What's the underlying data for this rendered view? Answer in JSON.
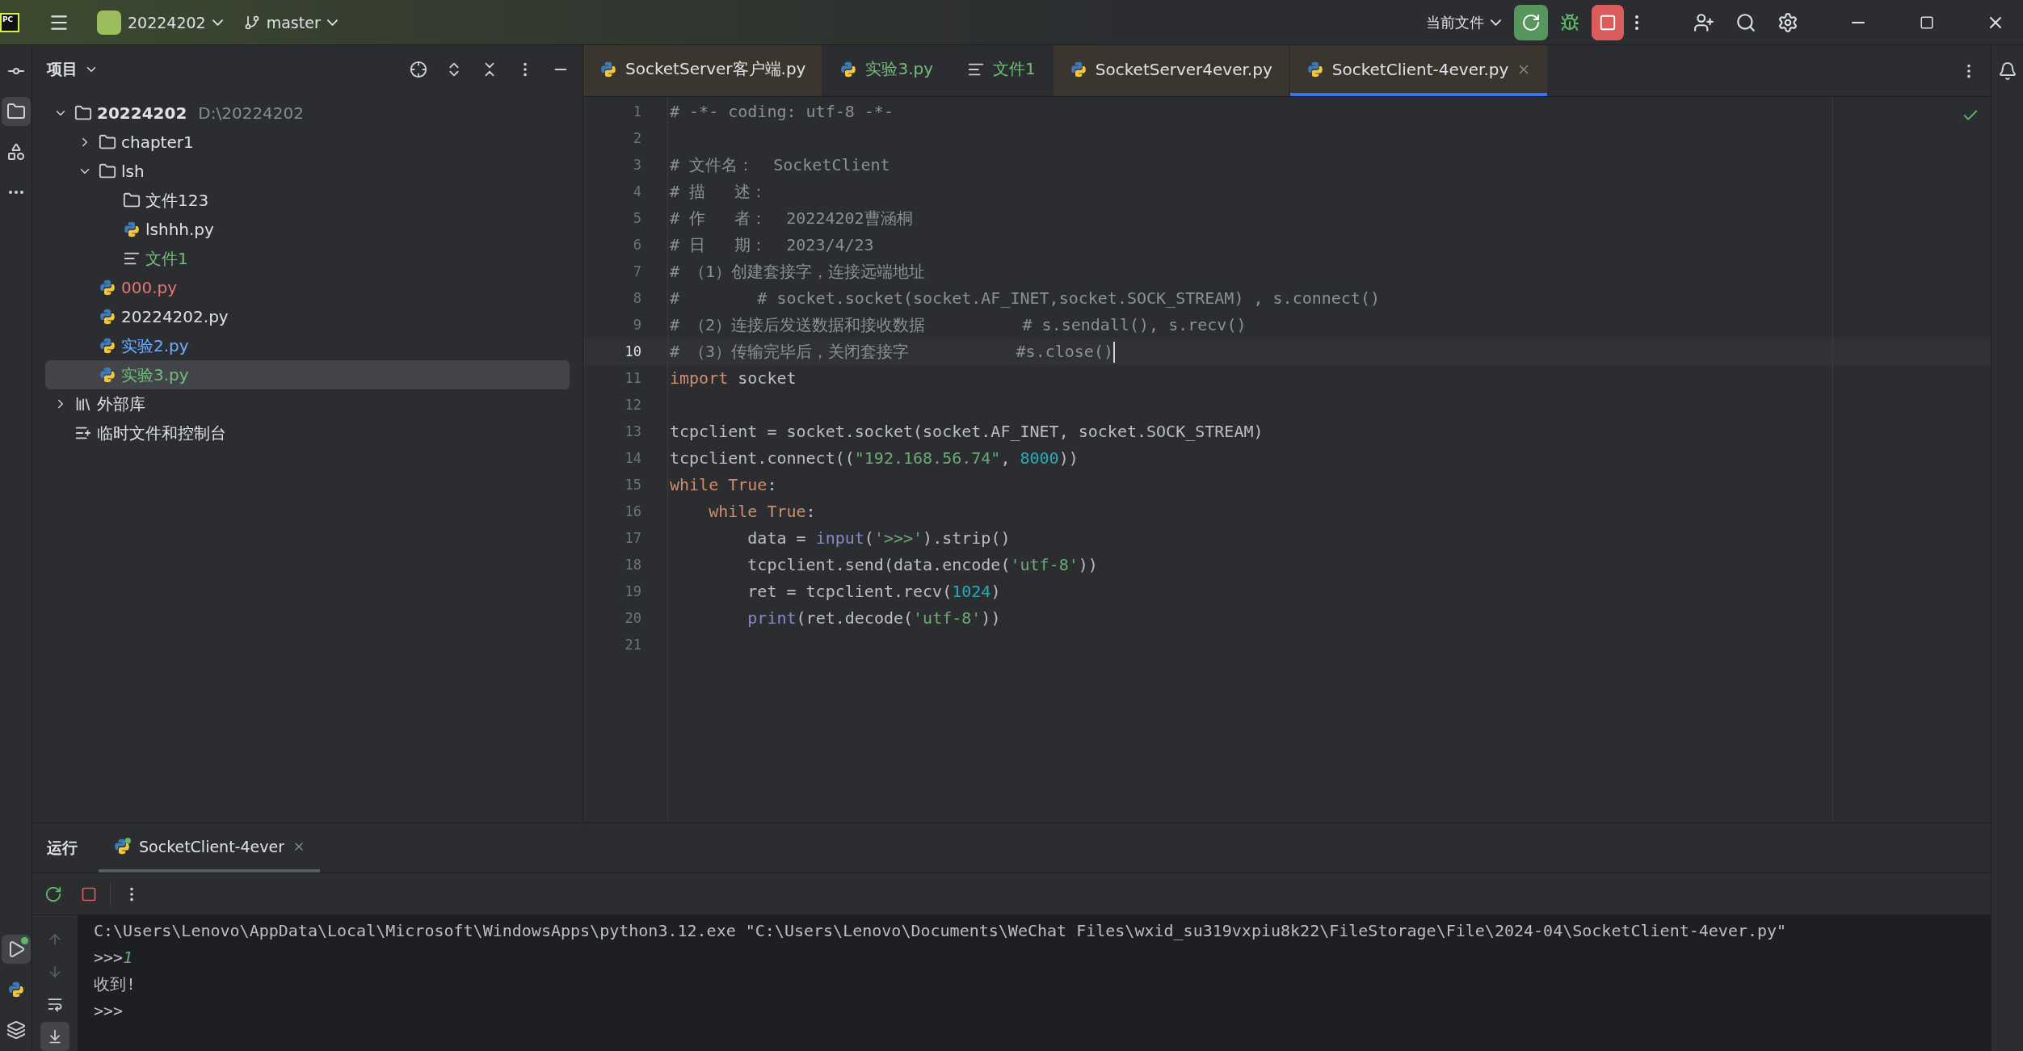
{
  "title_bar": {
    "logo": "PC",
    "project": "20224202",
    "branch": "master",
    "run_config": "当前文件"
  },
  "project_panel": {
    "title": "项目",
    "tree": [
      {
        "name": "20224202",
        "path": "D:\\20224202",
        "kind": "folder",
        "expanded": true,
        "selected": false,
        "color": "#dfe1e5",
        "children": [
          {
            "name": "chapter1",
            "kind": "folder",
            "expanded": false,
            "selected": false,
            "color": "#dfe1e5"
          },
          {
            "name": "lsh",
            "kind": "folder",
            "expanded": true,
            "selected": false,
            "color": "#dfe1e5",
            "children": [
              {
                "name": "文件123",
                "kind": "folder",
                "selected": false,
                "color": "#dfe1e5"
              },
              {
                "name": "lshhh.py",
                "kind": "python",
                "selected": false,
                "color": "#dfe1e5"
              },
              {
                "name": "文件1",
                "kind": "text",
                "selected": false,
                "color": "#73bd79"
              }
            ]
          },
          {
            "name": "000.py",
            "kind": "python",
            "selected": false,
            "color": "#e37774"
          },
          {
            "name": "20224202.py",
            "kind": "python",
            "selected": false,
            "color": "#dfe1e5"
          },
          {
            "name": "实验2.py",
            "kind": "python",
            "selected": false,
            "color": "#70aeff"
          },
          {
            "name": "实验3.py",
            "kind": "python",
            "selected": true,
            "color": "#73bd79"
          }
        ]
      },
      {
        "name": "外部库",
        "kind": "library",
        "expanded": false,
        "selected": false,
        "color": "#dfe1e5"
      },
      {
        "name": "临时文件和控制台",
        "kind": "scratches",
        "selected": false,
        "color": "#dfe1e5"
      }
    ]
  },
  "editor": {
    "tabs": [
      {
        "label": "SocketServer客户端.py",
        "kind": "python",
        "color": "#dfe1e5",
        "tinted": true,
        "selected": false
      },
      {
        "label": "实验3.py",
        "kind": "python",
        "color": "#73bd79",
        "tinted": false,
        "selected": false
      },
      {
        "label": "文件1",
        "kind": "text",
        "color": "#73bd79",
        "tinted": false,
        "selected": false
      },
      {
        "label": "SocketServer4ever.py",
        "kind": "python",
        "color": "#dfe1e5",
        "tinted": true,
        "selected": false
      },
      {
        "label": "SocketClient-4ever.py",
        "kind": "python",
        "color": "#dfe1e5",
        "tinted": true,
        "selected": true
      }
    ],
    "lines": [
      {
        "number": "1",
        "current": false,
        "tokens": [
          {
            "kind": "comment",
            "text": "# -*- coding: utf-8 -*-"
          }
        ]
      },
      {
        "number": "2",
        "current": false
      },
      {
        "number": "3",
        "current": false,
        "tokens": [
          {
            "kind": "comment",
            "text": "# 文件名：  SocketClient"
          }
        ]
      },
      {
        "number": "4",
        "current": false,
        "tokens": [
          {
            "kind": "comment",
            "text": "# 描   述："
          }
        ]
      },
      {
        "number": "5",
        "current": false,
        "tokens": [
          {
            "kind": "comment",
            "text": "# 作   者：  20224202曹涵桐"
          }
        ]
      },
      {
        "number": "6",
        "current": false,
        "tokens": [
          {
            "kind": "comment",
            "text": "# 日   期：  2023/4/23"
          }
        ]
      },
      {
        "number": "7",
        "current": false,
        "tokens": [
          {
            "kind": "comment",
            "text": "# （1）创建套接字，连接远端地址"
          }
        ]
      },
      {
        "number": "8",
        "current": false,
        "tokens": [
          {
            "kind": "comment",
            "text": "#        # socket.socket(socket.AF_INET,socket.SOCK_STREAM) , s.connect()"
          }
        ]
      },
      {
        "number": "9",
        "current": false,
        "tokens": [
          {
            "kind": "comment",
            "text": "# （2）连接后发送数据和接收数据          # s.sendall(), s.recv()"
          }
        ]
      },
      {
        "number": "10",
        "current": true,
        "tokens": [
          {
            "kind": "comment",
            "text": "# （3）传输完毕后，关闭套接字           #s.close()"
          }
        ]
      },
      {
        "number": "11",
        "current": false,
        "tokens": [
          {
            "kind": "keyword",
            "text": "import"
          },
          {
            "kind": "plain",
            "text": " socket"
          }
        ]
      },
      {
        "number": "12",
        "current": false
      },
      {
        "number": "13",
        "current": false,
        "tokens": [
          {
            "kind": "plain",
            "text": "tcpclient = socket.socket(socket.AF_INET, socket.SOCK_STREAM)"
          }
        ]
      },
      {
        "number": "14",
        "current": false,
        "tokens": [
          {
            "kind": "plain",
            "text": "tcpclient.connect(("
          },
          {
            "kind": "string",
            "text": "\"192.168.56.74\""
          },
          {
            "kind": "plain",
            "text": ", "
          },
          {
            "kind": "number",
            "text": "8000"
          },
          {
            "kind": "plain",
            "text": "))"
          }
        ]
      },
      {
        "number": "15",
        "current": false,
        "tokens": [
          {
            "kind": "keyword",
            "text": "while True"
          },
          {
            "kind": "plain",
            "text": ":"
          }
        ]
      },
      {
        "number": "16",
        "current": false,
        "tokens": [
          {
            "kind": "keyword",
            "text": "    while True"
          },
          {
            "kind": "plain",
            "text": ":"
          }
        ]
      },
      {
        "number": "17",
        "current": false,
        "tokens": [
          {
            "kind": "plain",
            "text": "        data = "
          },
          {
            "kind": "builtin",
            "text": "input"
          },
          {
            "kind": "plain",
            "text": "("
          },
          {
            "kind": "string",
            "text": "'>>>'"
          },
          {
            "kind": "plain",
            "text": ").strip()"
          }
        ]
      },
      {
        "number": "18",
        "current": false,
        "tokens": [
          {
            "kind": "plain",
            "text": "        tcpclient.send(data.encode("
          },
          {
            "kind": "string",
            "text": "'utf-8'"
          },
          {
            "kind": "plain",
            "text": "))"
          }
        ]
      },
      {
        "number": "19",
        "current": false,
        "tokens": [
          {
            "kind": "plain",
            "text": "        ret = tcpclient.recv("
          },
          {
            "kind": "number",
            "text": "1024"
          },
          {
            "kind": "plain",
            "text": ")"
          }
        ]
      },
      {
        "number": "20",
        "current": false,
        "tokens": [
          {
            "kind": "builtin",
            "text": "        print"
          },
          {
            "kind": "plain",
            "text": "(ret.decode("
          },
          {
            "kind": "string",
            "text": "'utf-8'"
          },
          {
            "kind": "plain",
            "text": "))"
          }
        ]
      },
      {
        "number": "21",
        "current": false
      }
    ]
  },
  "run_panel": {
    "title": "运行",
    "tabs": [
      {
        "label": "SocketClient-4ever",
        "selected": true
      }
    ],
    "console": [
      {
        "kind": "command",
        "text": "C:\\Users\\Lenovo\\AppData\\Local\\Microsoft\\WindowsApps\\python3.12.exe \"C:\\Users\\Lenovo\\Documents\\WeChat Files\\wxid_su319vxpiu8k22\\FileStorage\\File\\2024-04\\SocketClient-4ever.py\""
      },
      {
        "kind": "prompt",
        "prompt": ">>>",
        "input": "1"
      },
      {
        "kind": "output",
        "text": "收到!"
      },
      {
        "kind": "prompt",
        "prompt": ">>>"
      }
    ]
  }
}
